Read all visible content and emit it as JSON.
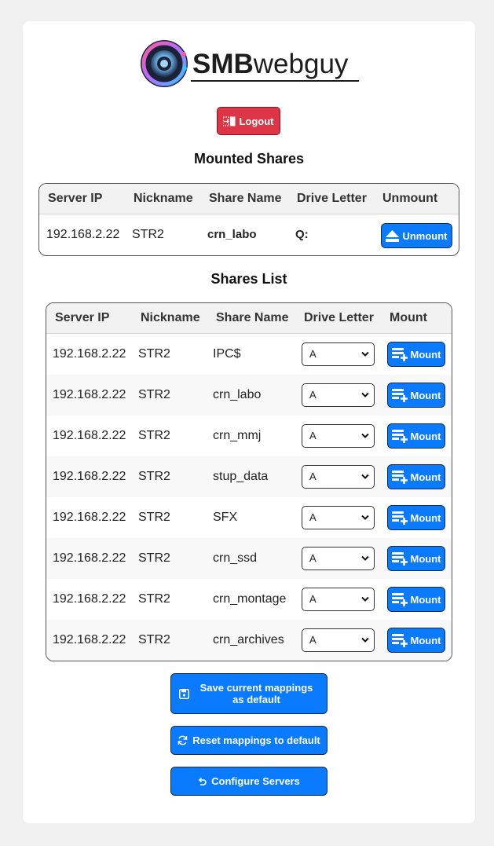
{
  "brand": {
    "name_bold": "SMB",
    "name_light": "webguy"
  },
  "logout_label": "Logout",
  "mounted": {
    "title": "Mounted Shares",
    "headers": [
      "Server IP",
      "Nickname",
      "Share Name",
      "Drive Letter",
      "Unmount"
    ],
    "rows": [
      {
        "ip": "192.168.2.22",
        "nickname": "STR2",
        "share": "crn_labo",
        "drive": "Q:",
        "action": "Unmount"
      }
    ]
  },
  "shares": {
    "title": "Shares List",
    "headers": [
      "Server IP",
      "Nickname",
      "Share Name",
      "Drive Letter",
      "Mount"
    ],
    "rows": [
      {
        "ip": "192.168.2.22",
        "nickname": "STR2",
        "share": "IPC$",
        "drive": "A",
        "action": "Mount"
      },
      {
        "ip": "192.168.2.22",
        "nickname": "STR2",
        "share": "crn_labo",
        "drive": "A",
        "action": "Mount"
      },
      {
        "ip": "192.168.2.22",
        "nickname": "STR2",
        "share": "crn_mmj",
        "drive": "A",
        "action": "Mount"
      },
      {
        "ip": "192.168.2.22",
        "nickname": "STR2",
        "share": "stup_data",
        "drive": "A",
        "action": "Mount"
      },
      {
        "ip": "192.168.2.22",
        "nickname": "STR2",
        "share": "SFX",
        "drive": "A",
        "action": "Mount"
      },
      {
        "ip": "192.168.2.22",
        "nickname": "STR2",
        "share": "crn_ssd",
        "drive": "A",
        "action": "Mount"
      },
      {
        "ip": "192.168.2.22",
        "nickname": "STR2",
        "share": "crn_montage",
        "drive": "A",
        "action": "Mount"
      },
      {
        "ip": "192.168.2.22",
        "nickname": "STR2",
        "share": "crn_archives",
        "drive": "A",
        "action": "Mount"
      }
    ]
  },
  "actions": {
    "save_label": "Save current mappings as default",
    "reset_label": "Reset mappings to default",
    "configure_label": "Configure Servers"
  },
  "colors": {
    "primary": "#0a7bff",
    "danger": "#dc3545",
    "background": "#f0f0f0"
  },
  "icons": {
    "logout": "logout-icon",
    "unmount": "eject-icon",
    "mount": "add-drive-icon",
    "save": "save-icon",
    "reset": "refresh-icon",
    "configure": "undo-icon"
  }
}
